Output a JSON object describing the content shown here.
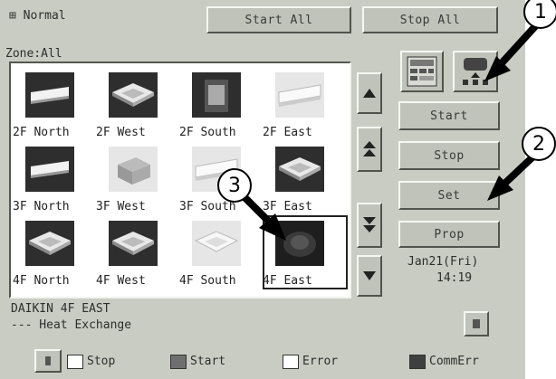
{
  "header": {
    "mode_label": "Normal",
    "zone_label": "Zone:All",
    "start_all_label": "Start All",
    "stop_all_label": "Stop All"
  },
  "units": [
    {
      "label": "2F North",
      "kind": "dark-cassette",
      "selected": false
    },
    {
      "label": "2F West",
      "kind": "dark-cassette-angled",
      "selected": false
    },
    {
      "label": "2F South",
      "kind": "dark-panel",
      "selected": false
    },
    {
      "label": "2F East",
      "kind": "light-wall",
      "selected": false
    },
    {
      "label": "3F North",
      "kind": "dark-cassette",
      "selected": false
    },
    {
      "label": "3F West",
      "kind": "light-box",
      "selected": false
    },
    {
      "label": "3F South",
      "kind": "light-wall",
      "selected": false
    },
    {
      "label": "3F East",
      "kind": "dark-cassette-angled",
      "selected": false
    },
    {
      "label": "4F North",
      "kind": "dark-cassette-angled",
      "selected": false
    },
    {
      "label": "4F West",
      "kind": "dark-cassette-angled",
      "selected": false
    },
    {
      "label": "4F South",
      "kind": "light-cassette",
      "selected": false
    },
    {
      "label": "4F East",
      "kind": "dark-round",
      "selected": true
    }
  ],
  "side": {
    "start_label": "Start",
    "stop_label": "Stop",
    "set_label": "Set",
    "prop_label": "Prop",
    "date_text": "Jan21(Fri)",
    "time_text": "14:19"
  },
  "status": {
    "line1": "DAIKIN 4F EAST",
    "line2": "--- Heat Exchange"
  },
  "legend": {
    "stop": "Stop",
    "start": "Start",
    "error": "Error",
    "commerr": "CommErr"
  },
  "callouts": [
    "1",
    "2",
    "3"
  ],
  "colors": {
    "screen_bg": "#c9ccc3",
    "button": "#bfc3b9",
    "unit_dark": "#2e2e2e",
    "legend_start": "#6f6f6f",
    "legend_commerr": "#3f3f3f"
  }
}
